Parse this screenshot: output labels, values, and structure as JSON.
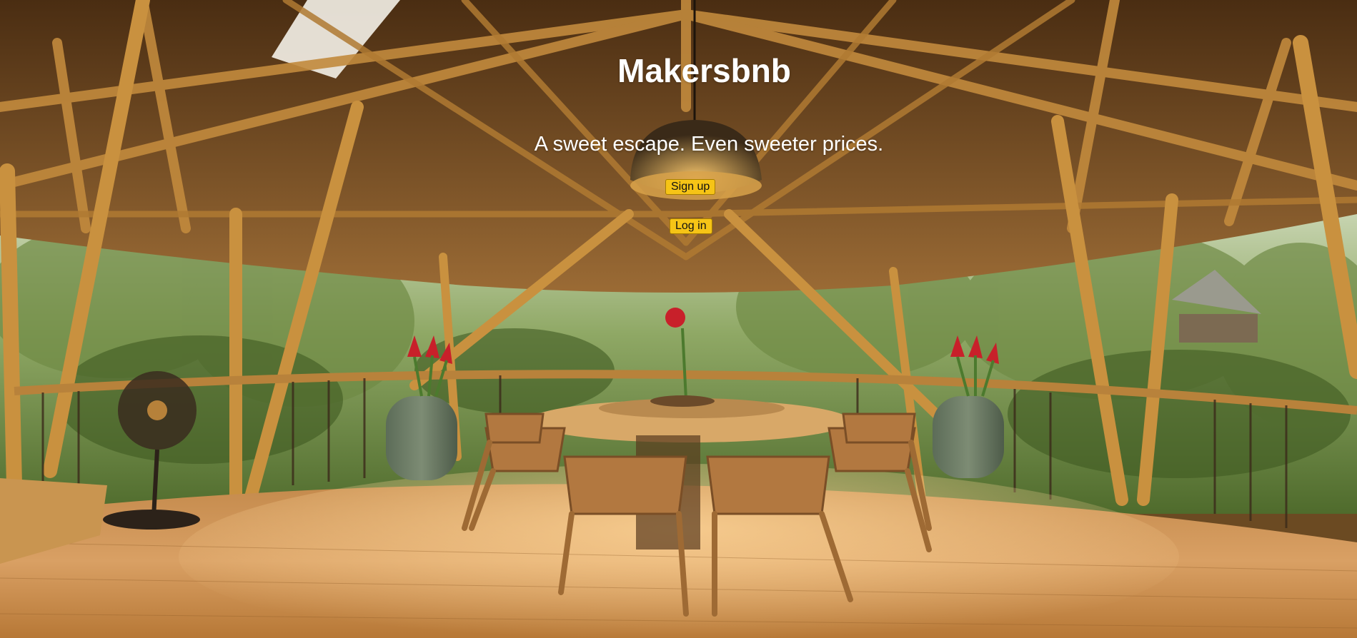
{
  "page": {
    "title": "Makersbnb",
    "tagline": "A sweet escape. Even sweeter prices."
  },
  "actions": {
    "signup_label": "Sign up",
    "login_label": "Log in"
  },
  "theme": {
    "button_color": "#f6c416",
    "title_color": "#ffffff"
  },
  "background": {
    "description_icon": "bamboo-pavilion-dining-photo"
  }
}
